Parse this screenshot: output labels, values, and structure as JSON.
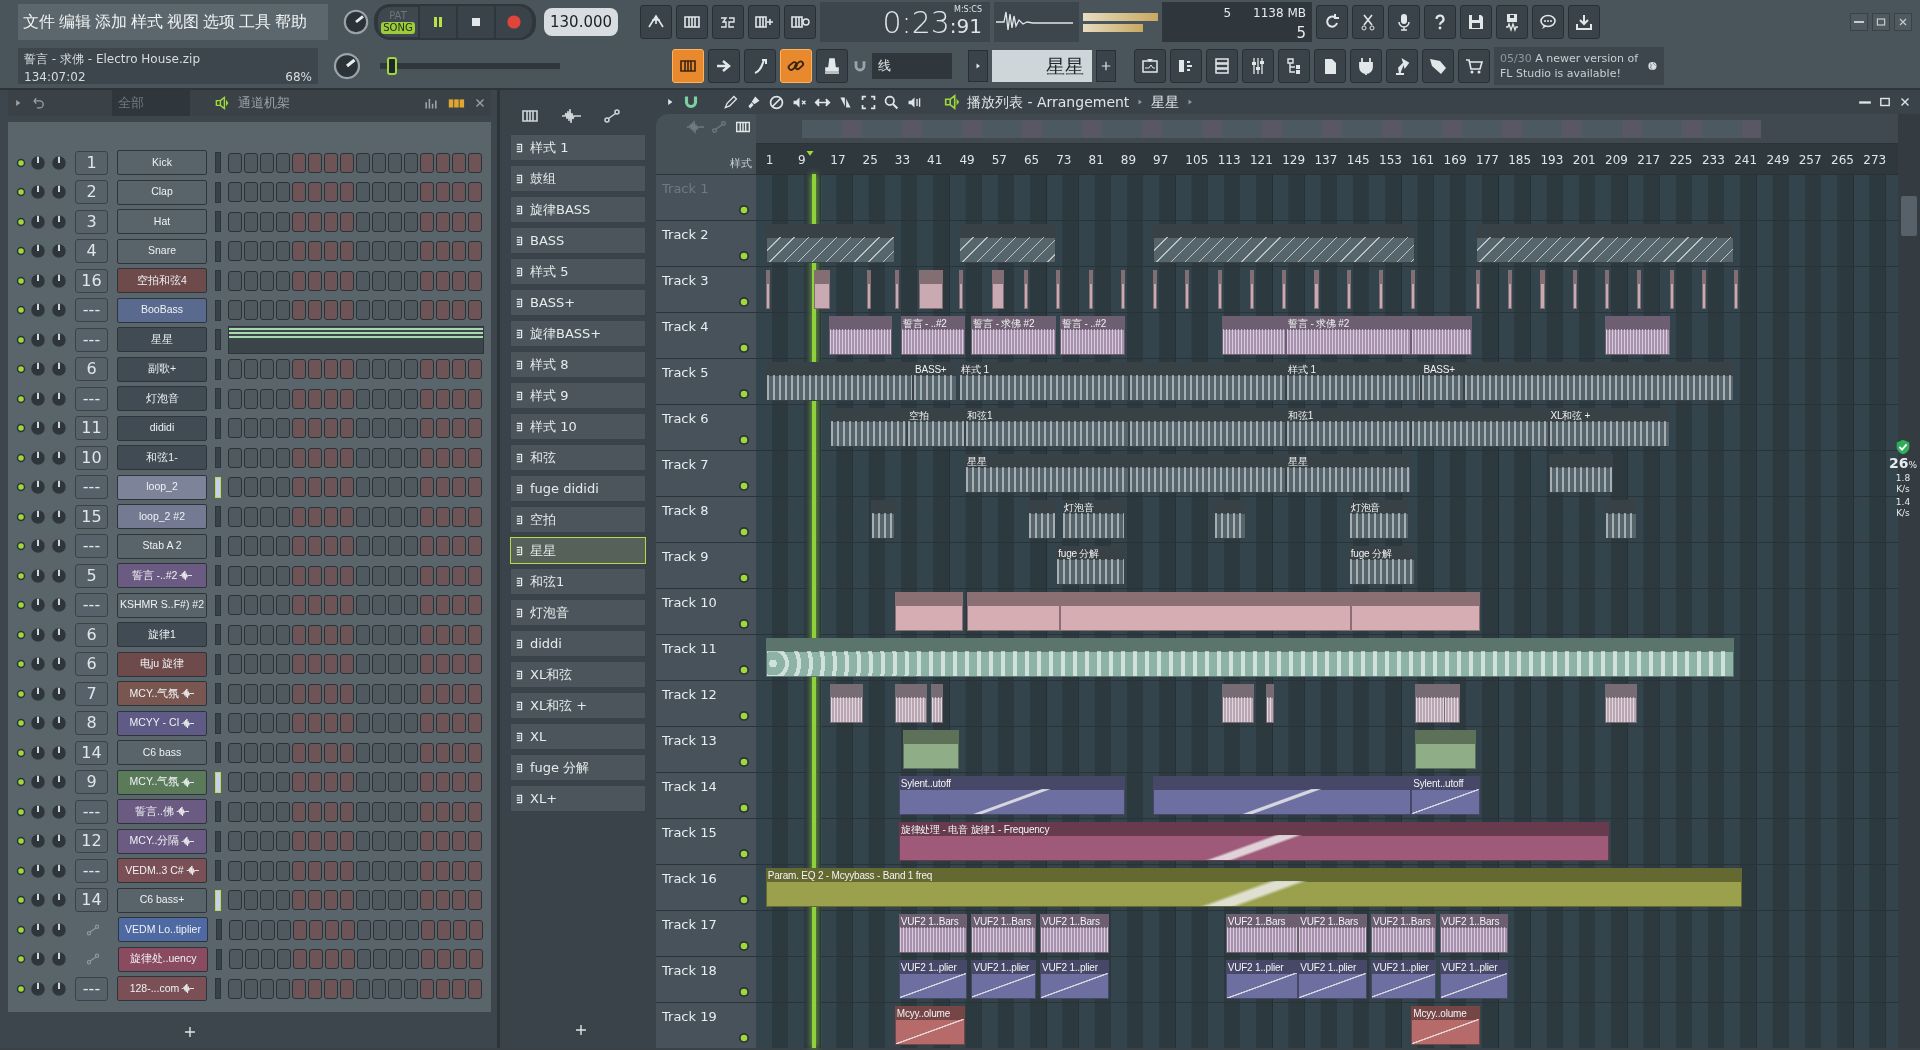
{
  "menu": [
    "文件",
    "编辑",
    "添加",
    "样式",
    "视图",
    "选项",
    "工具",
    "帮助"
  ],
  "project": {
    "name": "誓言 - 求佛 - Electro House.zip",
    "time": "134:07:02",
    "zoom": "68%"
  },
  "transport": {
    "modes": [
      {
        "label": "PAT",
        "selected": false
      },
      {
        "label": "SONG",
        "selected": true
      }
    ],
    "playing": true,
    "tempo": "130.000"
  },
  "clock": {
    "time": "0:23",
    "centis": ":91",
    "format": "M:S:CS"
  },
  "monitor": {
    "voices": "5",
    "memory": "1138 MB",
    "polyphony": "5"
  },
  "view_buttons": [
    {
      "on": true
    },
    {
      "on": false
    },
    {
      "on": false
    },
    {
      "on": true
    },
    {
      "on": false
    }
  ],
  "pitch_slider": {
    "level": 0.04
  },
  "snap": "线",
  "pattern": "星星",
  "news": {
    "date": "05/30",
    "text": "A newer version of FL Studio is available!"
  },
  "channel_rack": {
    "filter": "全部",
    "title": "通道机架",
    "channels": [
      {
        "number": "1",
        "name": "Kick",
        "color": "#59636a",
        "kind": "steps",
        "audio": false,
        "selected": false
      },
      {
        "number": "2",
        "name": "Clap",
        "color": "#59636a",
        "kind": "steps",
        "audio": false,
        "selected": false
      },
      {
        "number": "3",
        "name": "Hat",
        "color": "#59636a",
        "kind": "steps",
        "audio": false,
        "selected": false
      },
      {
        "number": "4",
        "name": "Snare",
        "color": "#59636a",
        "kind": "steps",
        "audio": false,
        "selected": false
      },
      {
        "number": "16",
        "name": "空拍和弦4",
        "color": "#6e4a4a",
        "kind": "steps",
        "audio": false,
        "selected": false
      },
      {
        "number": "---",
        "name": "BooBass",
        "color": "#5a6a8e",
        "kind": "steps",
        "audio": false,
        "selected": false
      },
      {
        "number": "---",
        "name": "星星",
        "color": "#414b53",
        "kind": "pianoroll",
        "audio": false,
        "selected": false
      },
      {
        "number": "6",
        "name": "副歌+",
        "color": "#414b53",
        "kind": "steps",
        "audio": false,
        "selected": false
      },
      {
        "number": "---",
        "name": "灯泡音",
        "color": "#414b53",
        "kind": "steps",
        "audio": false,
        "selected": false
      },
      {
        "number": "11",
        "name": "dididi",
        "color": "#414b53",
        "kind": "steps",
        "audio": false,
        "selected": false
      },
      {
        "number": "10",
        "name": "和弦1-",
        "color": "#414b53",
        "kind": "steps",
        "audio": false,
        "selected": false
      },
      {
        "number": "---",
        "name": "loop_2",
        "color": "#7d8399",
        "kind": "steps",
        "audio": false,
        "selected": true
      },
      {
        "number": "15",
        "name": "loop_2 #2",
        "color": "#737a92",
        "kind": "steps",
        "audio": false,
        "selected": false
      },
      {
        "number": "---",
        "name": "Stab A 2",
        "color": "#59636a",
        "kind": "steps",
        "audio": false,
        "selected": false
      },
      {
        "number": "5",
        "name": "誓言 -..#2",
        "color": "#6b5a82",
        "kind": "steps",
        "audio": true,
        "selected": false
      },
      {
        "number": "---",
        "name": "KSHMR S..F#) #2",
        "color": "#59636a",
        "kind": "steps",
        "audio": false,
        "selected": false
      },
      {
        "number": "6",
        "name": "旋律1",
        "color": "#414b53",
        "kind": "steps",
        "audio": false,
        "selected": false
      },
      {
        "number": "6",
        "name": "电ju 旋律",
        "color": "#6e4a4a",
        "kind": "steps",
        "audio": false,
        "selected": false
      },
      {
        "number": "7",
        "name": "MCY..气氛",
        "color": "#7a5650",
        "kind": "steps",
        "audio": true,
        "selected": false
      },
      {
        "number": "8",
        "name": "MCYY - CI",
        "color": "#5f5a86",
        "kind": "steps",
        "audio": true,
        "selected": false
      },
      {
        "number": "14",
        "name": "C6 bass",
        "color": "#59636a",
        "kind": "steps",
        "audio": false,
        "selected": false
      },
      {
        "number": "9",
        "name": "MCY..气氛",
        "color": "#5a7a5a",
        "kind": "steps",
        "audio": true,
        "selected": true
      },
      {
        "number": "---",
        "name": "誓言..佛",
        "color": "#6b5a82",
        "kind": "steps",
        "audio": true,
        "selected": false
      },
      {
        "number": "12",
        "name": "MCY..分隔",
        "color": "#6b5a82",
        "kind": "steps",
        "audio": true,
        "selected": false
      },
      {
        "number": "---",
        "name": "VEDM..3 C#",
        "color": "#7a4f56",
        "kind": "steps",
        "audio": true,
        "selected": false
      },
      {
        "number": "14",
        "name": "C6 bass+",
        "color": "#59636a",
        "kind": "steps",
        "audio": false,
        "selected": true
      },
      {
        "name": "VEDM Lo..tiplier",
        "color": "#4f6aa2",
        "kind": "automation",
        "audio": false,
        "selected": false
      },
      {
        "name": "旋律处..uency",
        "color": "#8a4a60",
        "kind": "automation",
        "audio": false,
        "selected": false
      },
      {
        "number": "---",
        "name": "128-...com",
        "color": "#7a4f56",
        "kind": "steps",
        "audio": true,
        "selected": false
      }
    ]
  },
  "picker": {
    "items": [
      {
        "label": "样式 1",
        "selected": false
      },
      {
        "label": "鼓组",
        "selected": false
      },
      {
        "label": "旋律BASS",
        "selected": false
      },
      {
        "label": "BASS",
        "selected": false
      },
      {
        "label": "样式 5",
        "selected": false
      },
      {
        "label": "BASS+",
        "selected": false
      },
      {
        "label": "旋律BASS+",
        "selected": false
      },
      {
        "label": "样式 8",
        "selected": false
      },
      {
        "label": "样式 9",
        "selected": false
      },
      {
        "label": "样式 10",
        "selected": false
      },
      {
        "label": "和弦",
        "selected": false
      },
      {
        "label": "fuge dididi",
        "selected": false
      },
      {
        "label": "空拍",
        "selected": false
      },
      {
        "label": "星星",
        "selected": true
      },
      {
        "label": "和弦1",
        "selected": false
      },
      {
        "label": "灯泡音",
        "selected": false
      },
      {
        "label": "diddi",
        "selected": false
      },
      {
        "label": "XL和弦",
        "selected": false
      },
      {
        "label": "XL和弦 +",
        "selected": false
      },
      {
        "label": "XL",
        "selected": false
      },
      {
        "label": "fuge 分解",
        "selected": false
      },
      {
        "label": "XL+",
        "selected": false
      }
    ]
  },
  "playlist": {
    "title": "播放列表 - Arrangement",
    "pattern": "星星",
    "corner_label": "样式",
    "ruler": [
      "1",
      "9",
      "17",
      "25",
      "33",
      "41",
      "49",
      "57",
      "65",
      "73",
      "81",
      "89",
      "97",
      "105",
      "113",
      "121",
      "129",
      "137",
      "145",
      "153",
      "161",
      "169",
      "177",
      "185",
      "193",
      "201",
      "209",
      "217",
      "225",
      "233",
      "241",
      "249",
      "257",
      "265",
      "273"
    ],
    "tracks": [
      {
        "name": "Track 1"
      },
      {
        "name": "Track 2",
        "color": "#56646c"
      },
      {
        "name": "Track 3",
        "color": "#c9a9b2"
      },
      {
        "name": "Track 4",
        "color": "#a891ae",
        "clips": [
          {
            "label": "誓言 - ..#2"
          },
          {
            "label": "誓言 - 求佛 #2"
          },
          {
            "label": "誓言 - ..#2"
          },
          {
            "label": "誓言 - 求佛 #2"
          }
        ]
      },
      {
        "name": "Track 5",
        "color": "#56646c",
        "clips": [
          {
            "label": "BASS+"
          },
          {
            "label": "样式 1"
          },
          {
            "label": "样式 1"
          },
          {
            "label": "BASS+"
          }
        ]
      },
      {
        "name": "Track 6",
        "color": "#56646c",
        "clips": [
          {
            "label": "空拍"
          },
          {
            "label": "和弦1"
          },
          {
            "label": "和弦1"
          },
          {
            "label": "XL和弦 +"
          }
        ]
      },
      {
        "name": "Track 7",
        "color": "#56646c",
        "clips": [
          {
            "label": "星星"
          },
          {
            "label": "星星"
          }
        ]
      },
      {
        "name": "Track 8",
        "color": "#56646c",
        "clips": [
          {
            "label": "灯泡音"
          },
          {
            "label": "灯泡音"
          }
        ]
      },
      {
        "name": "Track 9",
        "color": "#56646c",
        "clips": [
          {
            "label": "fuge 分解"
          },
          {
            "label": "fuge 分解"
          }
        ]
      },
      {
        "name": "Track 10",
        "color": "#d5adb3"
      },
      {
        "name": "Track 11",
        "color": "#8db3a6"
      },
      {
        "name": "Track 12",
        "color": "#b9a6b2"
      },
      {
        "name": "Track 13",
        "color": "#8fae88"
      },
      {
        "name": "Track 14",
        "color": "#6d6fa0",
        "clips": [
          {
            "label": "Sylent..utoff"
          },
          {
            "label": "Sylent..utoff"
          }
        ]
      },
      {
        "name": "Track 15",
        "color": "#9e5a78",
        "clips": [
          {
            "label": "旋律处理 - 电音 旋律1 - Frequency"
          }
        ]
      },
      {
        "name": "Track 16",
        "color": "#9aa04c",
        "clips": [
          {
            "label": "Param. EQ 2 - Mcyybass - Band 1 freq"
          }
        ]
      },
      {
        "name": "Track 17",
        "color": "#a891ae",
        "clips": [
          {
            "label": "VUF2 1..Bars"
          },
          {
            "label": "VUF2 1..Bars"
          },
          {
            "label": "VUF2 1..Bars"
          },
          {
            "label": "VUF2 1..Bars"
          },
          {
            "label": "VUF2 1..Bars"
          },
          {
            "label": "VUF2 1..Bars"
          },
          {
            "label": "VUF2 1..Bars"
          }
        ]
      },
      {
        "name": "Track 18",
        "color": "#6d6fa0",
        "clips": [
          {
            "label": "VUF2 1..plier"
          },
          {
            "label": "VUF2 1..plier"
          },
          {
            "label": "VUF2 1..plier"
          },
          {
            "label": "VUF2 1..plier"
          },
          {
            "label": "VUF2 1..plier"
          },
          {
            "label": "VUF2 1..plier"
          },
          {
            "label": "VUF2 1..plier"
          }
        ]
      },
      {
        "name": "Track 19",
        "color": "#b66a6a",
        "clips": [
          {
            "label": "Mcyy..olume"
          },
          {
            "label": "Mcyy..olume"
          }
        ]
      }
    ]
  },
  "cpu": {
    "percent": "26",
    "unit": "%",
    "rates": [
      {
        "value": "1.8",
        "unit": "K/s"
      },
      {
        "value": "1.4",
        "unit": "K/s"
      }
    ]
  }
}
